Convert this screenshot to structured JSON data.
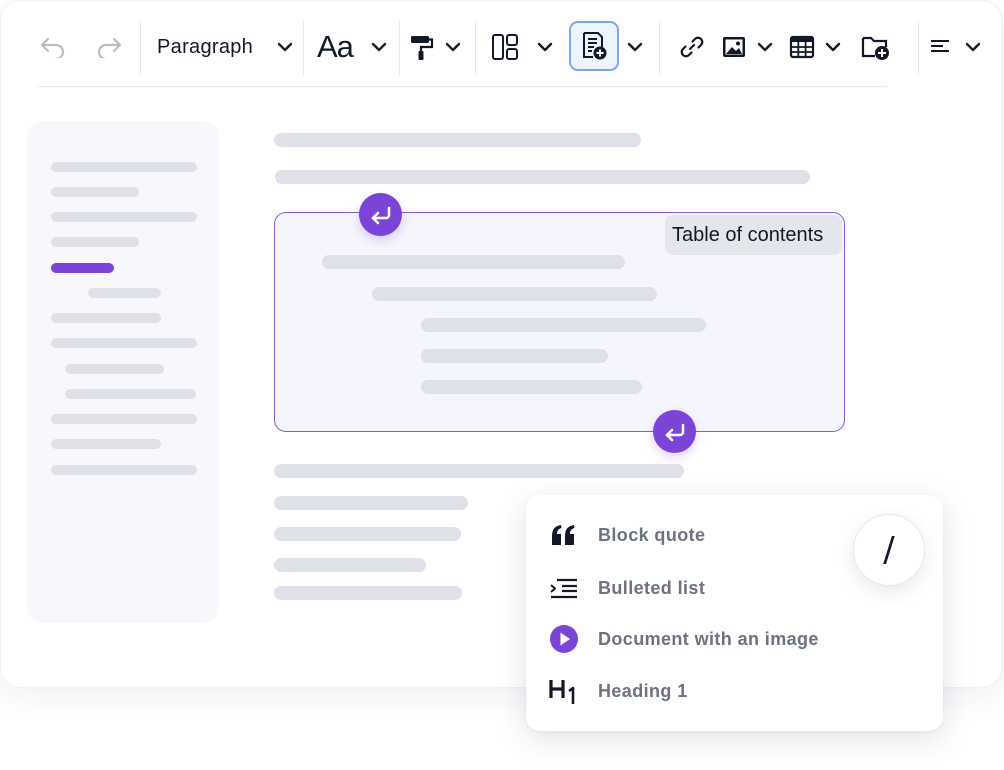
{
  "toolbar": {
    "paragraph_style": "Paragraph",
    "font_label": "Aa",
    "active_tool": "table-of-contents",
    "icons": [
      "undo-icon",
      "redo-icon",
      "text-style-icon",
      "paint-roller-icon",
      "layout-icon",
      "toc-icon",
      "link-icon",
      "image-icon",
      "table-icon",
      "add-folder-icon",
      "align-left-icon"
    ]
  },
  "document": {
    "toc_label": "Table of contents"
  },
  "slash_menu": {
    "trigger": "/",
    "items": [
      {
        "label": "Block quote",
        "icon": "quote-icon"
      },
      {
        "label": "Bulleted list",
        "icon": "bulleted-list-icon"
      },
      {
        "label": "Document with an image",
        "icon": "play-circle-icon"
      },
      {
        "label": "Heading 1",
        "icon": "heading-1-icon"
      }
    ]
  },
  "colors": {
    "accent": "#7b44d6",
    "skeleton": "#dfe1e8",
    "selection_border": "#7aa7f0",
    "toc_background": "#f5f6fd"
  }
}
